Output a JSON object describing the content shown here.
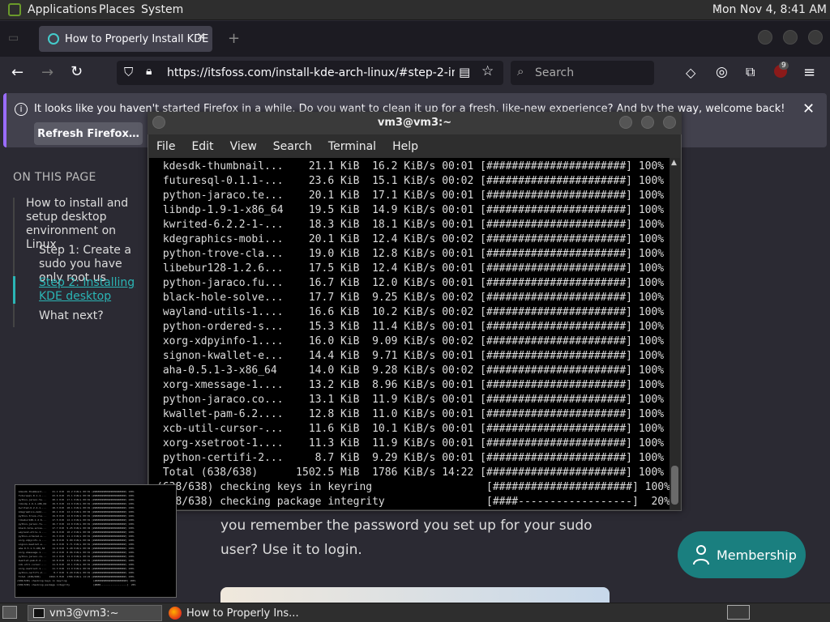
{
  "panel": {
    "menus": [
      "Applications",
      "Places",
      "System"
    ],
    "clock": "Mon Nov 4,  8:41 AM"
  },
  "browser": {
    "tab_title": "How to Properly Install KDE",
    "url": "https://itsfoss.com/install-kde-arch-linux/#step-2-install",
    "search_placeholder": "Search",
    "badge_count": "9",
    "notification": "It looks like you haven't started Firefox in a while. Do you want to clean it up for a fresh, like-new experience? And by the way, welcome back!",
    "refresh_button": "Refresh Firefox…"
  },
  "page": {
    "toc_title": "ON THIS PAGE",
    "toc_items": [
      "How to install and setup desktop environment on Linux",
      "Step 1: Create a sudo you have only root us",
      "Step 2: Installing KDE desktop",
      "What next?"
    ],
    "article_text": "you remember the password you set up for your sudo user? Use it to login.",
    "membership_button": "Membership"
  },
  "terminal": {
    "title": "vm3@vm3:~",
    "menu": [
      "File",
      "Edit",
      "View",
      "Search",
      "Terminal",
      "Help"
    ],
    "lines": [
      " kdesdk-thumbnail...    21.1 KiB  16.2 KiB/s 00:01 [######################] 100%",
      " futuresql-0.1.1-...    23.6 KiB  15.1 KiB/s 00:02 [######################] 100%",
      " python-jaraco.te...    20.1 KiB  17.1 KiB/s 00:01 [######################] 100%",
      " libndp-1.9-1-x86_64    19.5 KiB  14.9 KiB/s 00:01 [######################] 100%",
      " kwrited-6.2.2-1-...    18.3 KiB  18.1 KiB/s 00:01 [######################] 100%",
      " kdegraphics-mobi...    20.1 KiB  12.4 KiB/s 00:02 [######################] 100%",
      " python-trove-cla...    19.0 KiB  12.8 KiB/s 00:01 [######################] 100%",
      " libebur128-1.2.6...    17.5 KiB  12.4 KiB/s 00:01 [######################] 100%",
      " python-jaraco.fu...    16.7 KiB  12.0 KiB/s 00:01 [######################] 100%",
      " black-hole-solve...    17.7 KiB  9.25 KiB/s 00:02 [######################] 100%",
      " wayland-utils-1....    16.6 KiB  10.2 KiB/s 00:02 [######################] 100%",
      " python-ordered-s...    15.3 KiB  11.4 KiB/s 00:01 [######################] 100%",
      " xorg-xdpyinfo-1....    16.0 KiB  9.09 KiB/s 00:02 [######################] 100%",
      " signon-kwallet-e...    14.4 KiB  9.71 KiB/s 00:01 [######################] 100%",
      " aha-0.5.1-3-x86_64     14.0 KiB  9.28 KiB/s 00:02 [######################] 100%",
      " xorg-xmessage-1....    13.2 KiB  8.96 KiB/s 00:01 [######################] 100%",
      " python-jaraco.co...    13.1 KiB  11.9 KiB/s 00:01 [######################] 100%",
      " kwallet-pam-6.2....    12.8 KiB  11.0 KiB/s 00:01 [######################] 100%",
      " xcb-util-cursor-...    11.6 KiB  10.1 KiB/s 00:01 [######################] 100%",
      " xorg-xsetroot-1....    11.3 KiB  11.9 KiB/s 00:01 [######################] 100%",
      " python-certifi-2...     8.7 KiB  9.29 KiB/s 00:01 [######################] 100%",
      " Total (638/638)      1502.5 MiB  1786 KiB/s 14:22 [######################] 100%",
      "(638/638) checking keys in keyring                  [######################] 100%",
      "(638/638) checking package integrity                [####------------------]  20%"
    ]
  },
  "taskbar": {
    "terminal_task": "vm3@vm3:~",
    "browser_task": "How to Properly Ins..."
  }
}
